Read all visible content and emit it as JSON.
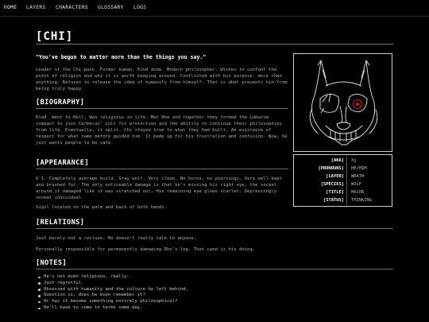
{
  "nav": [
    "HOME",
    "LAYERS",
    "CHARACTERS",
    "GLOSSARY",
    "LOGS"
  ],
  "page": {
    "title": "[CHI]",
    "quote": "\"You've begun to matter more than the things you say.\"",
    "intro": "Leader of the Chi pack. Former human. Kind dude. Modern philosopher. Wishes to confont the point of religion and why it is worth keeping around. Conflicted with his purpose, more than anything. Refuses to release the idea of humanity from himself. That is what prevents him from being truly happy."
  },
  "sections": {
    "biography": {
      "heading": "[BIOGRAPHY]",
      "text": "Died. Went to Hell. Was religious in life. Met Rho and together they formed the Labarum compact to join Cerberus' cult for protection and the ability to continue their philosophies from life. Eventually, it split. Chi stayed true to what they had built. An existence of respect for what came before guided him. It made up for his frustration and confusion. Now, he just wants people to be safe."
    },
    "appearance": {
      "heading": "[APPEARANCE]",
      "text": "6'1. Completely average build. Gray wolf. Very clean. No horns, no piercings. Very well-kept and brushed fur. The only noticeable damage is that he's missing his right eye, the socket around it damaged like it was scratched out. His remaining eye glows scarlet. Depressingly normal individual.",
      "sigil": "Sigil located on the palm and back of both hands."
    },
    "relations": {
      "heading": "[RELATIONS]",
      "line1": "Just barely not a recluse. He doesn't really talk to anyone.",
      "line2": "Personally responsible for permanently damaging Rho's leg. That cane is his doing."
    },
    "notes": {
      "heading": "[NOTES]",
      "items": [
        "He's not even religious, really.",
        "Just regretful.",
        "Obsessed with humanity and the culture he left behind.",
        "Question is, does he even remember it?",
        "Or has it become something entirely philosophical?",
        "He'll have to come to terms some day."
      ]
    }
  },
  "infobox": [
    {
      "label": "[AKA]",
      "value": "Xχ"
    },
    {
      "label": "[PRONOUNS]",
      "value": "HE/HIM"
    },
    {
      "label": "[LAYER]",
      "value": "WRATH"
    },
    {
      "label": "[SPECIES]",
      "value": "WOLF"
    },
    {
      "label": "[TITLE]",
      "value": "MAJOR"
    },
    {
      "label": "[STATUS]",
      "value": "THINKING"
    }
  ],
  "colors": {
    "background": "#000000",
    "text": "#bdbdbd",
    "heading": "#ffffff",
    "eye": "#c81e1e"
  }
}
